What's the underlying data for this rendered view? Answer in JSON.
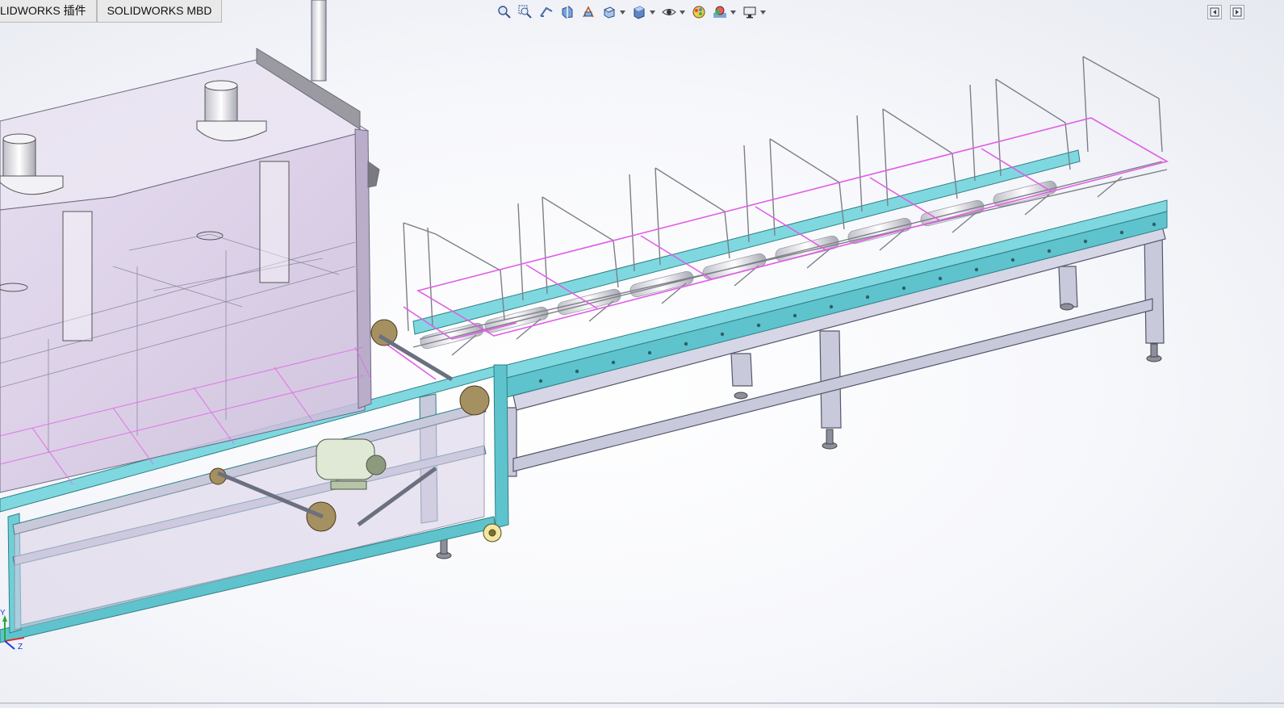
{
  "tabs": [
    {
      "label": "LIDWORKS 插件"
    },
    {
      "label": "SOLIDWORKS MBD"
    }
  ],
  "heads_up_toolbar": [
    {
      "icon": "zoom-to-fit-icon",
      "caret": false
    },
    {
      "icon": "zoom-to-area-icon",
      "caret": false
    },
    {
      "icon": "previous-view-icon",
      "caret": false
    },
    {
      "icon": "section-view-icon",
      "caret": false
    },
    {
      "icon": "dynamic-annotation-icon",
      "caret": false
    },
    {
      "icon": "view-orientation-icon",
      "caret": true
    },
    {
      "icon": "display-style-icon",
      "caret": true
    },
    {
      "icon": "hide-show-items-icon",
      "caret": true
    },
    {
      "icon": "edit-appearance-icon",
      "caret": false
    },
    {
      "icon": "apply-scene-icon",
      "caret": true
    },
    {
      "icon": "view-settings-icon",
      "caret": true
    }
  ],
  "triad": {
    "y_label": "Y",
    "z_label": "Z"
  },
  "colors": {
    "frame_teal": "#6fd0d8",
    "frame_edge": "#2f7f86",
    "transparent_body": "#cfc2dc",
    "guard_pink": "#e05ee6",
    "steel": "#c9c9d6"
  }
}
